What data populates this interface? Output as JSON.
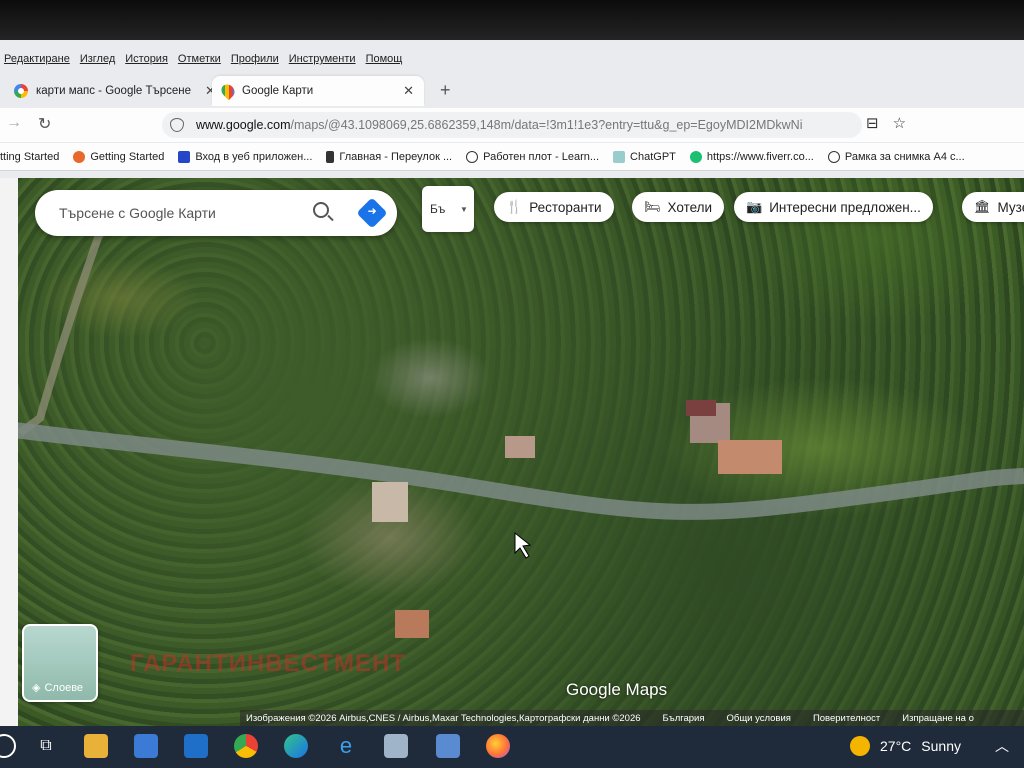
{
  "menu": [
    "Редактиране",
    "Изглед",
    "История",
    "Отметки",
    "Профили",
    "Инструменти",
    "Помощ"
  ],
  "tabs": [
    {
      "label": "карти мапс - Google Търсене",
      "active": false
    },
    {
      "label": "Google Карти",
      "active": true
    }
  ],
  "url": {
    "host": "www.google.com",
    "rest": "/maps/@43.1098069,25.6862359,148m/data=!3m1!1e3?entry=ttu&g_ep=EgoyMDI2MDkwNi"
  },
  "bookmarks": [
    "tting Started",
    "Getting Started",
    "Вход в уеб приложен...",
    "Главная - Переулок ...",
    "Работен плот - Learn...",
    "ChatGPT",
    "https://www.fiverr.co...",
    "Рамка за снимка А4 с..."
  ],
  "search": {
    "placeholder": "Търсене с Google Карти"
  },
  "lang": "Бъ",
  "chips": [
    {
      "icon": "restaurant-icon",
      "label": "Ресторанти"
    },
    {
      "icon": "hotel-icon",
      "label": "Хотели"
    },
    {
      "icon": "camera-icon",
      "label": "Интересни предложен..."
    },
    {
      "icon": "museum-icon",
      "label": "Музе"
    }
  ],
  "layers_label": "Слоеве",
  "watermark": "ГАРАНТИНВЕСТМЕНТ",
  "brand": "Google Maps",
  "attribution": [
    "Изображения ©2026 Airbus,CNES / Airbus,Maxar Technologies,Картографски данни ©2026",
    "България",
    "Общи условия",
    "Поверителност",
    "Изпращане на о"
  ],
  "weather": {
    "temp": "27°C",
    "condition": "Sunny"
  },
  "colors": {
    "accent": "#1a73e8",
    "taskbar": "#1f2b3a"
  }
}
